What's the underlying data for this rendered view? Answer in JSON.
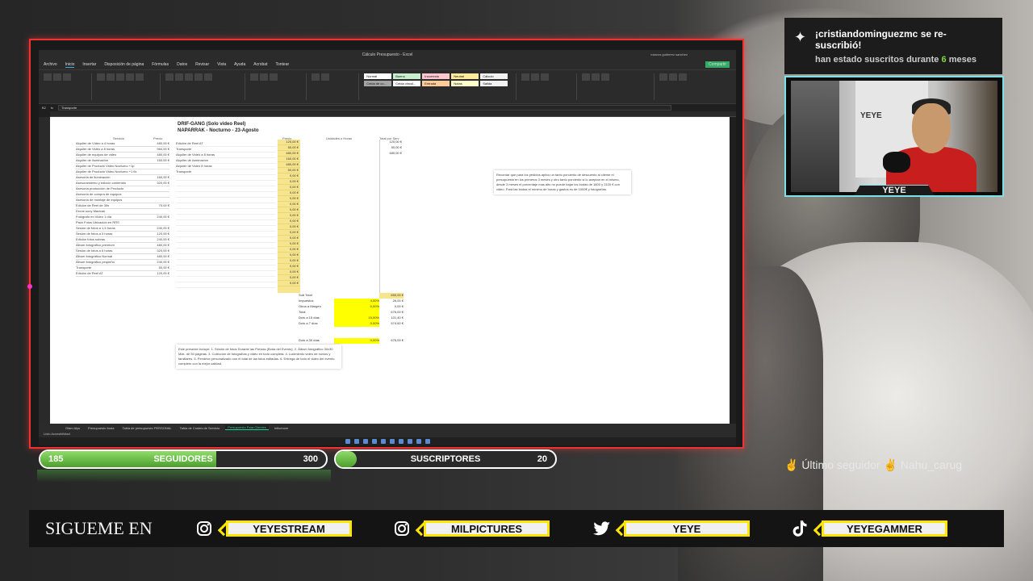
{
  "excel": {
    "title": "Cálculo Presupuesto - Excel",
    "user": "marcos gutierrez sanchez",
    "menu": [
      "Archivo",
      "Inicio",
      "Insertar",
      "Disposición de página",
      "Fórmulas",
      "Datos",
      "Revisar",
      "Vista",
      "Ayuda",
      "Acrobat",
      "Tontear"
    ],
    "share_label": "Compartir",
    "cell_ref": "B2",
    "formula": "Transporte",
    "styles": [
      "Normal",
      "Bueno",
      "Incorrecto",
      "Neutral",
      "Cálculo",
      "Celda de co...",
      "Celda vincul...",
      "Entrada",
      "Notas",
      "Salida"
    ],
    "title1": "DRIF-GANG (Solo video Reel)",
    "title2": "NAPARRAK - Nocturno - 23-Agosto",
    "col_headers": {
      "servicio": "Servicio",
      "precio": "Precio",
      "precio2": "Precio",
      "unidades": "Unidades o Horas",
      "total": "Total por Serv"
    },
    "services": [
      {
        "name": "Alquiler de Vídeo a 4 horas",
        "price": "480,00 €"
      },
      {
        "name": "Alquiler de Video a 8 horas",
        "price": "960,00 €"
      },
      {
        "name": "Alquiler de equipos de video",
        "price": "480,00 €"
      },
      {
        "name": "Alquiler de iluminación",
        "price": "160,00 €"
      },
      {
        "name": "Alquiler de Producto Video Nocturno +1p",
        "price": ""
      },
      {
        "name": "Alquiler de Producto Video Nocturno +1 fix",
        "price": ""
      },
      {
        "name": "Asesoría de iluminación",
        "price": "160,00 €"
      },
      {
        "name": "Asesoramiento y edición contenido",
        "price": "320,00 €"
      },
      {
        "name": "Asesoría producción de Producto",
        "price": ""
      },
      {
        "name": "Asesoría de compra de equipos",
        "price": ""
      },
      {
        "name": "Asesoría de montaje de equipos",
        "price": ""
      },
      {
        "name": "Edición de Reel de 30s",
        "price": "70,00 €"
      },
      {
        "name": "Drone sony Mavicair",
        "price": ""
      },
      {
        "name": "Fotógrafo en Video 1 día",
        "price": "240,00 €"
      },
      {
        "name": "Pack Fotos Ubicación en RRS",
        "price": ""
      },
      {
        "name": "Sesión de fotos a 1,5 horas",
        "price": "240,00 €"
      },
      {
        "name": "Sesión de fotos a 3 horas",
        "price": "120,00 €"
      },
      {
        "name": "Edición fotos sobras",
        "price": "240,00 €"
      },
      {
        "name": "Álbum fotográfico premium",
        "price": "480,00 €"
      },
      {
        "name": "Sesión de fotos a 6 horas",
        "price": "320,00 €"
      },
      {
        "name": "Álbum fotográfico Normal",
        "price": "480,00 €"
      },
      {
        "name": "Álbum fotográfico pequeño",
        "price": "240,00 €"
      },
      {
        "name": "Transporte",
        "price": "50,00 €"
      },
      {
        "name": "Edición de Reel AT",
        "price": "120,00 €"
      }
    ],
    "order_items": [
      "Edición de Reel AT",
      "Transporte",
      "Alquiler de Video a 8 horas",
      "Alquiler de iluminación",
      "Alquiler de Video 8 horas",
      "Transporte"
    ],
    "unit_prices": [
      "120,00 €",
      "50,00 €",
      "480,00 €",
      "160,00 €",
      "480,00 €",
      "50,00 €",
      "0,00 €",
      "0,00 €",
      "0,00 €",
      "0,00 €",
      "0,00 €",
      "0,00 €",
      "0,00 €",
      "0,00 €",
      "0,00 €",
      "0,00 €",
      "0,00 €",
      "0,00 €",
      "0,00 €",
      "0,00 €",
      "0,00 €",
      "0,00 €",
      "0,00 €",
      "0,00 €",
      "0,00 €",
      "0,00 €"
    ],
    "totals": [
      "120,00 €",
      "50,00 €",
      "480,00 €",
      "",
      "",
      "",
      "",
      "",
      "",
      "",
      "",
      "",
      "",
      "",
      "",
      "",
      "",
      "",
      "",
      "",
      "",
      "",
      "",
      "",
      "",
      ""
    ],
    "summary": [
      {
        "label": "Sub Total",
        "pct": "",
        "value": "650,00 €"
      },
      {
        "label": "Impuestos",
        "pct": "4,00%",
        "value": "26,00 €"
      },
      {
        "label": "Otros a Margen",
        "pct": "0,00%",
        "value": "0,00 €"
      },
      {
        "label": "Total",
        "pct": "",
        "value": "676,00 €"
      },
      {
        "label": "Dcto a 15 días",
        "pct": "15,00%",
        "value": "101,40 €"
      },
      {
        "label": "Dcto a 7 días",
        "pct": "0,00%",
        "value": "574,60 €"
      },
      {
        "label": "Dcto a 30 días",
        "pct": "0,00%",
        "value": "676,00 €"
      }
    ],
    "note_right": "Recordar que para los pedidos aplico un tanto porciento de descuento al cliente el presupuesto en los primeros 3 meses y otro tanto porciento si lo aceptan en el mismo, desde 3 meses el porcentaje mas alto no puede bajar los bodas de 1800 y 2100 € con video. Para las bodas el mínimo de horas y gastos es de 1000€ y fotografías.",
    "note_bottom": "Este presente incluye: 1. Sesión de fotos Durante las Previas (Boda del Evento). 2. Álbum fotográfico 30x30 Máx. de 50 páginas. 3. Colección de fotografías y video en todo completa. 4. Lucimiento video de novios y familiares. 5. Pendrive personalizado con el total de las fotos editadas. 6. Entrega de todo el video del evento completo con la mejor calidad.",
    "tabs": [
      "Glam Alys",
      "Presupuesto boda",
      "Tabla de presupuesto PERSONAL",
      "Tabla de Costes de Servicio",
      "Presupuesto Para Clientes",
      "Influencer"
    ],
    "status": "Listo  Accesibilidad"
  },
  "alert": {
    "line1": "¡cristiandominguezmc se re-suscribió!",
    "line2_pre": "han estado suscritos durante",
    "line2_num": "6",
    "line2_post": "meses"
  },
  "cam": {
    "poster": "YEYE",
    "label": "YEYE"
  },
  "ticker": "✌ Último seguidor ✌ Nahu_carug",
  "followers": {
    "current": "185",
    "label": "SEGUIDORES",
    "goal": "300",
    "progress": 0.617
  },
  "subs": {
    "current": "",
    "label": "SUSCRIPTORES",
    "goal": "20",
    "progress": 0.04
  },
  "socials": {
    "label": "SIGUEME EN",
    "items": [
      {
        "icon": "instagram-icon",
        "handle": "YEYESTREAM"
      },
      {
        "icon": "instagram-icon",
        "handle": "MILPICTURES"
      },
      {
        "icon": "twitter-icon",
        "handle": "YEYE"
      },
      {
        "icon": "tiktok-icon",
        "handle": "YEYEGAMMER"
      }
    ]
  },
  "colors": {
    "accent_red": "#ee3333",
    "goal_green": "#5fb83d",
    "social_yellow": "#ffe600",
    "cam_border": "#7de2e8"
  }
}
